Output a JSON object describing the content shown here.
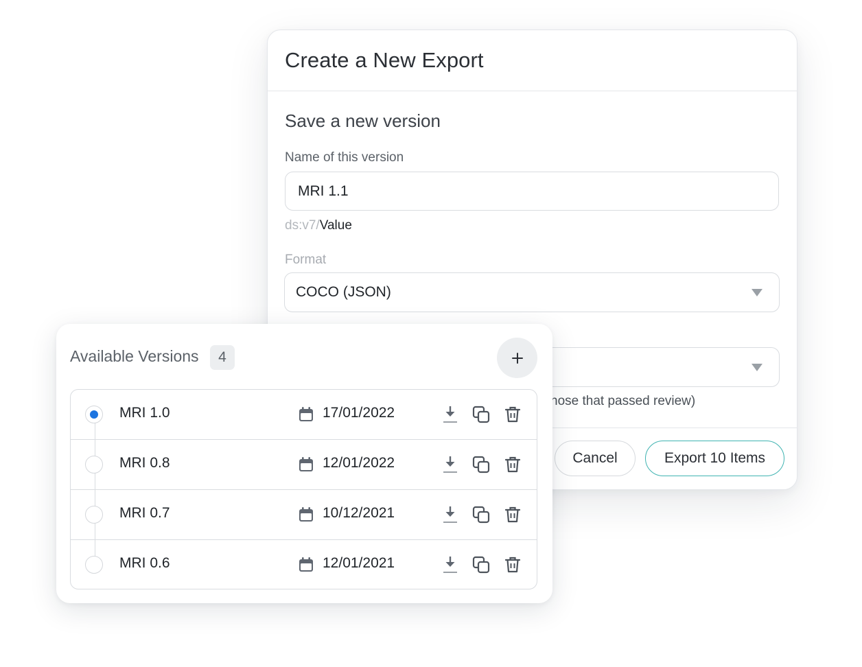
{
  "dialog": {
    "title": "Create a New Export",
    "section_title": "Save a new version",
    "name_label": "Name of this version",
    "name_value": "MRI 1.1",
    "slug_prefix": "ds:v7/",
    "slug_value": "Value",
    "format_label": "Format",
    "format_value": "COCO (JSON)",
    "filter_hint": "hose that passed review)",
    "cancel_label": "Cancel",
    "export_label": "Export 10 Items"
  },
  "versions": {
    "title": "Available Versions",
    "count": "4",
    "add_icon": "plus-icon",
    "items": [
      {
        "name": "MRI 1.0",
        "date": "17/01/2022",
        "selected": true
      },
      {
        "name": "MRI 0.8",
        "date": "12/01/2022",
        "selected": false
      },
      {
        "name": "MRI 0.7",
        "date": "10/12/2021",
        "selected": false
      },
      {
        "name": "MRI 0.6",
        "date": "12/01/2021",
        "selected": false
      }
    ],
    "row_icons": [
      "calendar-icon",
      "download-icon",
      "copy-icon",
      "trash-icon"
    ]
  },
  "colors": {
    "accent": "#3fb3b1",
    "selected_radio": "#1c74e0",
    "border": "#d9dce0",
    "badge_bg": "#eceef0"
  }
}
